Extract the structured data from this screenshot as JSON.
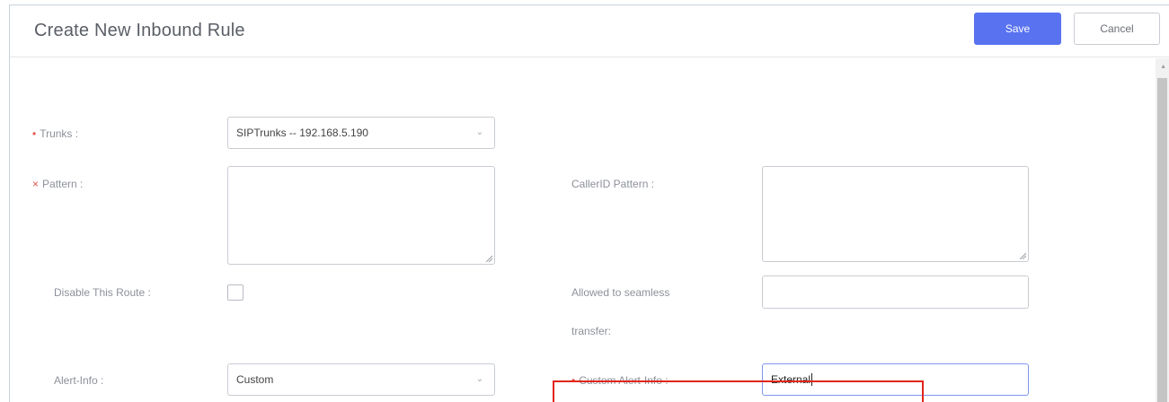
{
  "dialog": {
    "title": "Create New Inbound Rule",
    "save_label": "Save",
    "cancel_label": "Cancel"
  },
  "form": {
    "trunks": {
      "label": "Trunks :",
      "required": true,
      "value": "SIPTrunks -- 192.168.5.190"
    },
    "pattern": {
      "label": "Pattern :",
      "required": true,
      "value": ""
    },
    "callerid_pattern": {
      "label": "CallerID Pattern :",
      "value": ""
    },
    "disable_route": {
      "label": "Disable This Route :",
      "checked": false
    },
    "seamless_transfer": {
      "label_line1": "Allowed to seamless",
      "label_line2": "transfer:",
      "value": ""
    },
    "alert_info": {
      "label": "Alert-Info :",
      "value": "Custom"
    },
    "custom_alert_info": {
      "label": "Custom Alert-Info :",
      "required": true,
      "value": "External"
    }
  },
  "colors": {
    "primary": "#5872f0",
    "required": "#e0544b",
    "highlight": "#e1251b"
  },
  "icons": {
    "dropdown": "chevron-down-icon",
    "scroll_up": "scroll-up-arrow-icon",
    "resize": "resize-handle-icon"
  }
}
